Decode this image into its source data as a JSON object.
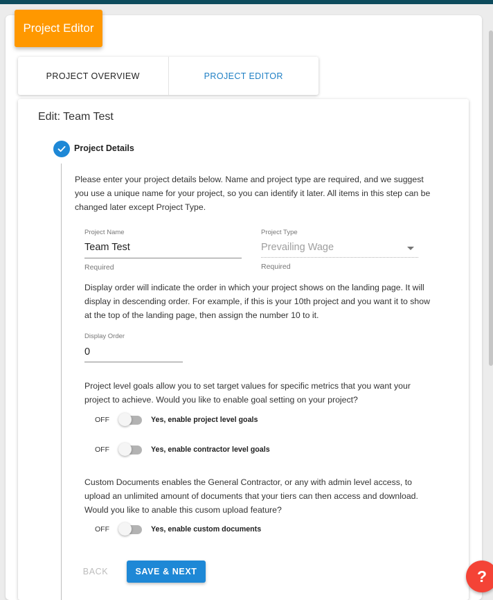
{
  "header": {
    "title": "Project Editor"
  },
  "tabs": [
    {
      "label": "PROJECT OVERVIEW",
      "active": false
    },
    {
      "label": "PROJECT EDITOR",
      "active": true
    }
  ],
  "edit": {
    "title": "Edit: Team Test",
    "step_title": "Project Details",
    "intro": "Please enter your project details below. Name and project type are required, and we suggest you use a unique name for your project, so you can identify it later. All items in this step can be changed later except Project Type.",
    "fields": {
      "project_name": {
        "label": "Project Name",
        "value": "Team Test",
        "helper": "Required"
      },
      "project_type": {
        "label": "Project Type",
        "value": "Prevailing Wage",
        "helper": "Required",
        "disabled": true
      },
      "display_order": {
        "label": "Display Order",
        "value": "0"
      }
    },
    "display_order_text": "Display order will indicate the order in which your project shows on the landing page. It will display in descending order. For example, if this is your 10th project and you want it to show at the top of the landing page, then assign the number 10 to it.",
    "goals_text": "Project level goals allow you to set target values for specific metrics that you want your project to achieve. Would you like to enable goal setting on your project?",
    "toggles": {
      "project_goals": {
        "state": "OFF",
        "label": "Yes, enable project level goals"
      },
      "contractor_goals": {
        "state": "OFF",
        "label": "Yes, enable contractor level goals"
      },
      "custom_documents": {
        "state": "OFF",
        "label": "Yes, enable custom documents"
      }
    },
    "documents_text": "Custom Documents enables the General Contractor, or any with admin level access, to upload an unlimited amount of documents that your tiers can then access and download. Would you like to anable this cusom upload feature?",
    "buttons": {
      "back": "BACK",
      "save_next": "SAVE & NEXT"
    }
  },
  "help_button": {
    "label": "?"
  },
  "colors": {
    "accent": "#1e88d6",
    "badge": "#ff9800",
    "help": "#f44336",
    "topbar": "#0d4b5c"
  },
  "icons": {
    "step": "check-icon",
    "select": "caret-down-icon",
    "help": "question-mark-icon"
  }
}
